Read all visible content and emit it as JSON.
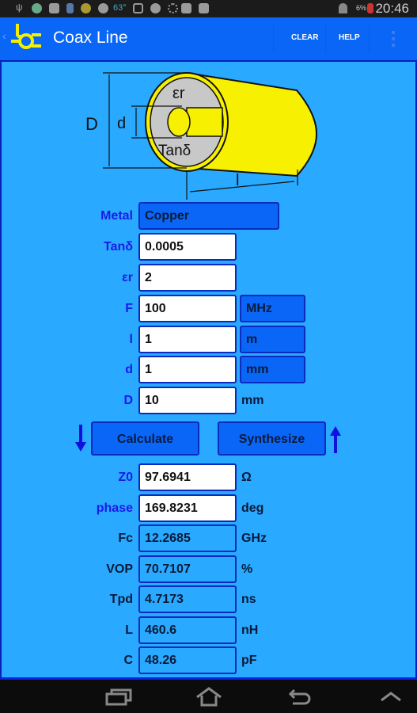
{
  "status_bar": {
    "temperature": "63°",
    "battery": "6%",
    "time": "20:46"
  },
  "action_bar": {
    "title": "Coax Line",
    "clear_label": "CLEAR",
    "help_label": "HELP"
  },
  "diagram": {
    "label_D": "D",
    "label_d": "d",
    "label_er": "εr",
    "label_tand": "Tanδ",
    "label_l": "l"
  },
  "inputs": {
    "metal": {
      "label": "Metal",
      "value": "Copper"
    },
    "tand": {
      "label": "Tanδ",
      "value": "0.0005"
    },
    "er": {
      "label": "εr",
      "value": "2"
    },
    "f": {
      "label": "F",
      "value": "100",
      "unit": "MHz"
    },
    "l": {
      "label": "l",
      "value": "1",
      "unit": "m"
    },
    "d": {
      "label": "d",
      "value": "1",
      "unit": "mm"
    },
    "D": {
      "label": "D",
      "value": "10",
      "unit": "mm"
    }
  },
  "buttons": {
    "calculate": "Calculate",
    "synthesize": "Synthesize"
  },
  "results": {
    "z0": {
      "label": "Z0",
      "value": "97.6941",
      "unit": "Ω"
    },
    "phase": {
      "label": "phase",
      "value": "169.8231",
      "unit": "deg"
    },
    "fc": {
      "label": "Fc",
      "value": "12.2685",
      "unit": "GHz"
    },
    "vop": {
      "label": "VOP",
      "value": "70.7107",
      "unit": "%"
    },
    "tpd": {
      "label": "Tpd",
      "value": "4.7173",
      "unit": "ns"
    },
    "L": {
      "label": "L",
      "value": "460.6",
      "unit": "nH"
    },
    "C": {
      "label": "C",
      "value": "48.26",
      "unit": "pF"
    }
  },
  "colors": {
    "accent": "#0a66f6",
    "background": "#29a9ff",
    "input_label": "#1a1ae8"
  }
}
